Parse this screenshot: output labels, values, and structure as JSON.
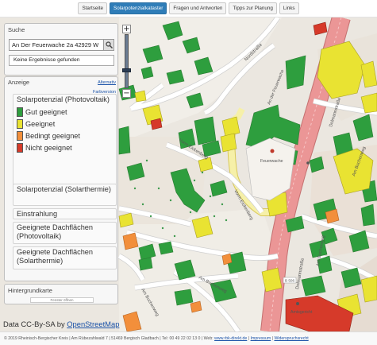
{
  "nav": {
    "items": [
      {
        "label": "Startseite"
      },
      {
        "label": "Solarpotenzialkataster"
      },
      {
        "label": "Fragen und Antworten"
      },
      {
        "label": "Tipps zur Planung"
      },
      {
        "label": "Links"
      }
    ],
    "active_index": 1
  },
  "search": {
    "title": "Suche",
    "value": "An Der Feuerwache 2a 42929 W",
    "result": "Keine Ergebnisse gefunden"
  },
  "display": {
    "title": "Anzeige",
    "link_alternative": "Alternativ",
    "link_farb": "Farbversion",
    "sections": [
      {
        "title": "Solarpotenzial (Photovoltaik)",
        "legend": [
          {
            "label": "Gut geeignet",
            "color": "#2e9e3e"
          },
          {
            "label": "Geeignet",
            "color": "#e9e332"
          },
          {
            "label": "Bedingt geeignet",
            "color": "#f28f3b"
          },
          {
            "label": "Nicht geeignet",
            "color": "#d63a2a"
          }
        ]
      },
      {
        "title": "Solarpotenzial (Solarthermie)"
      },
      {
        "title": "Einstrahlung"
      },
      {
        "title": "Geeignete Dachflächen (Photovoltaik)"
      },
      {
        "title": "Geeignete Dachflächen (Solarthermie)"
      }
    ]
  },
  "background": {
    "title": "Hintergrundkarte",
    "handle": "Fenster öffnen"
  },
  "attribution": {
    "prefix": "Data CC-By-SA by ",
    "link": "OpenStreetMap"
  },
  "map": {
    "labels": {
      "nordstrasse": "Nordstraße",
      "an_der_feuerwache": "An der Feuerwache",
      "dolmannstrasse": "Dolmannstraße",
      "vorm_eickenberg_1": "Vorm Eickenberg",
      "vorm_eickenberg_2": "Vorm Eickenberg",
      "am_buchenweg": "Am Buchenweg",
      "am_buchenweg_2": "Am Buchenweg",
      "feuerwache": "Feuerwache",
      "b506": "B 506",
      "amtsgericht": "Amtsgericht"
    },
    "colors": {
      "good": "#2e9e3e",
      "suitable": "#e9e332",
      "conditional": "#f28f3b",
      "unsuitable": "#d63a2a",
      "main_road": "#eb9696",
      "secondary_road": "#f6f0a8"
    }
  },
  "footer": {
    "text": "© 2019 Rheinisch-Bergischer Kreis | Am Rübezahlwald 7 | 51469 Bergisch Gladbach | Tel: 00 49 22 02 13 0 | Web: ",
    "link_web": "www.rbk-direkt.de",
    "sep": " | ",
    "link_impressum": "Impressum",
    "link_widerspruch": "Widerspruchsrecht"
  }
}
